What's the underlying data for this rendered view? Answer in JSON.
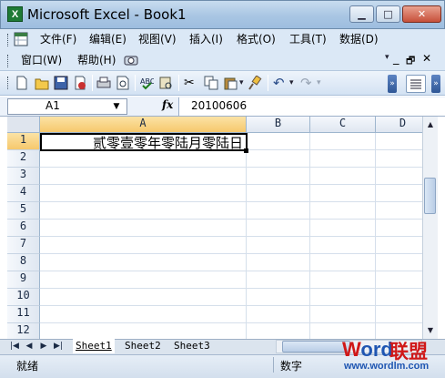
{
  "window": {
    "title": "Microsoft Excel - Book1",
    "app_icon": "X"
  },
  "menu": {
    "row1": [
      "文件(F)",
      "编辑(E)",
      "视图(V)",
      "插入(I)",
      "格式(O)",
      "工具(T)",
      "数据(D)"
    ],
    "row2": [
      "窗口(W)",
      "帮助(H)"
    ]
  },
  "formula_bar": {
    "name_box": "A1",
    "fx": "fx",
    "content": "20100606"
  },
  "columns": [
    "A",
    "B",
    "C",
    "D"
  ],
  "rows": [
    "1",
    "2",
    "3",
    "4",
    "5",
    "6",
    "7",
    "8",
    "9",
    "10",
    "11",
    "12"
  ],
  "cells": {
    "A1": "贰零壹零年零陆月零陆日"
  },
  "sheets": [
    "Sheet1",
    "Sheet2",
    "Sheet3"
  ],
  "status": {
    "ready": "就绪",
    "num": "数字"
  },
  "watermark": {
    "word": "Word",
    "lian": "联盟",
    "url": "www.wordlm.com"
  },
  "colors": {
    "accent": "#f6c86c",
    "title_bar": "#a9c6e3",
    "watermark_blue": "#1f56b2",
    "watermark_red": "#d01818"
  }
}
